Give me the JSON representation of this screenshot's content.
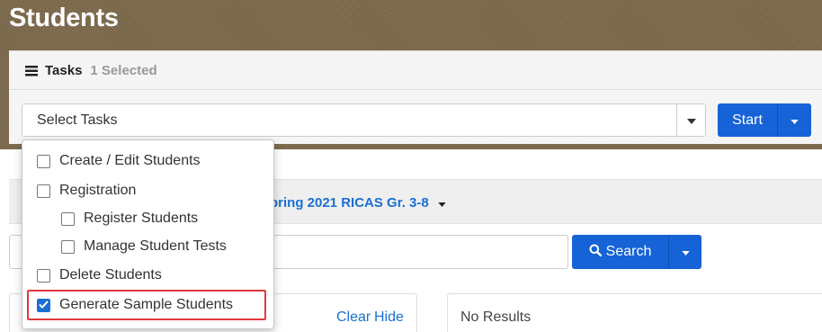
{
  "page": {
    "title": "Students"
  },
  "tasks": {
    "title": "Tasks",
    "selected_count": "1 Selected",
    "select_value": "Select Tasks",
    "start_label": "Start"
  },
  "task_options": [
    {
      "label": "Create / Edit Students",
      "checked": false
    },
    {
      "label": "Registration",
      "checked": false
    },
    {
      "label": "Register Students",
      "checked": false
    },
    {
      "label": "Manage Student Tests",
      "checked": false
    },
    {
      "label": "Delete Students",
      "checked": false
    },
    {
      "label": "Generate Sample Students",
      "checked": true
    }
  ],
  "admin": {
    "partial_text": "pring 2021 RICAS Gr. 3-8"
  },
  "search": {
    "button_label": "Search",
    "value": ""
  },
  "filters": {
    "clear_label": "Clear",
    "hide_label": "Hide"
  },
  "results": {
    "text": "No Results"
  },
  "colors": {
    "header_brown": "#7d6a4c",
    "primary_blue": "#1563d6",
    "highlight_red": "#e0393e"
  }
}
